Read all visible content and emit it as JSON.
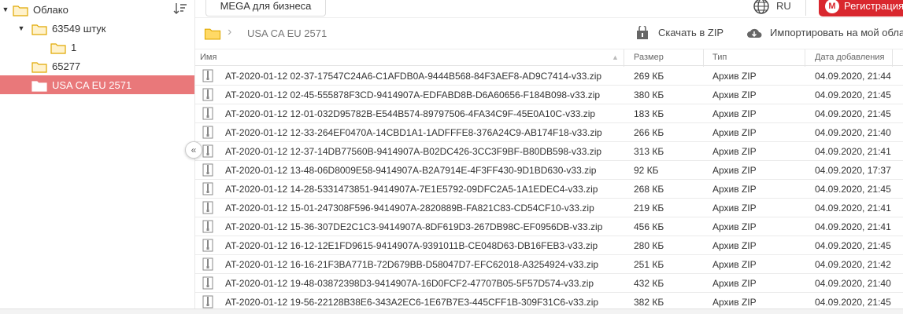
{
  "sidebar": {
    "items": [
      {
        "label": "Облако",
        "expanded": true,
        "selected": false
      },
      {
        "label": "63549 штук",
        "expanded": true,
        "selected": false
      },
      {
        "label": "1",
        "expanded": false,
        "selected": false
      },
      {
        "label": "65277",
        "expanded": false,
        "selected": false
      },
      {
        "label": "USA CA EU 2571",
        "expanded": false,
        "selected": true
      }
    ],
    "sort_icon": "sort-icon",
    "collapse_icon": "double-chevron-left-icon"
  },
  "topbar": {
    "business_label": "MEGA для бизнеса",
    "language": "RU",
    "register_label": "Регистрация",
    "register_logo": "M"
  },
  "breadcrumb": {
    "title": "USA CA EU 2571",
    "download_zip_label": "Скачать в ZIP",
    "import_label": "Импортировать на мой облако"
  },
  "table": {
    "columns": {
      "name": "Имя",
      "size": "Размер",
      "type": "Тип",
      "date": "Дата добавления"
    },
    "rows": [
      {
        "name": "AT-2020-01-12 02-37-17547C24A6-C1AFDB0A-9444B568-84F3AEF8-AD9C7414-v33.zip",
        "size": "269 КБ",
        "type": "Архив ZIP",
        "date": "04.09.2020, 21:44"
      },
      {
        "name": "AT-2020-01-12 02-45-555878F3CD-9414907A-EDFABD8B-D6A60656-F184B098-v33.zip",
        "size": "380 КБ",
        "type": "Архив ZIP",
        "date": "04.09.2020, 21:45"
      },
      {
        "name": "AT-2020-01-12 12-01-032D95782B-E544B574-89797506-4FA34C9F-45E0A10C-v33.zip",
        "size": "183 КБ",
        "type": "Архив ZIP",
        "date": "04.09.2020, 21:45"
      },
      {
        "name": "AT-2020-01-12 12-33-264EF0470A-14CBD1A1-1ADFFFE8-376A24C9-AB174F18-v33.zip",
        "size": "266 КБ",
        "type": "Архив ZIP",
        "date": "04.09.2020, 21:40"
      },
      {
        "name": "AT-2020-01-12 12-37-14DB77560B-9414907A-B02DC426-3CC3F9BF-B80DB598-v33.zip",
        "size": "313 КБ",
        "type": "Архив ZIP",
        "date": "04.09.2020, 21:41"
      },
      {
        "name": "AT-2020-01-12 13-48-06D8009E58-9414907A-B2A7914E-4F3FF430-9D1BD630-v33.zip",
        "size": "92 КБ",
        "type": "Архив ZIP",
        "date": "04.09.2020, 17:37"
      },
      {
        "name": "AT-2020-01-12 14-28-5331473851-9414907A-7E1E5792-09DFC2A5-1A1EDEC4-v33.zip",
        "size": "268 КБ",
        "type": "Архив ZIP",
        "date": "04.09.2020, 21:45"
      },
      {
        "name": "AT-2020-01-12 15-01-247308F596-9414907A-2820889B-FA821C83-CD54CF10-v33.zip",
        "size": "219 КБ",
        "type": "Архив ZIP",
        "date": "04.09.2020, 21:41"
      },
      {
        "name": "AT-2020-01-12 15-36-307DE2C1C3-9414907A-8DF619D3-267DB98C-EF0956DB-v33.zip",
        "size": "456 КБ",
        "type": "Архив ZIP",
        "date": "04.09.2020, 21:41"
      },
      {
        "name": "AT-2020-01-12 16-12-12E1FD9615-9414907A-9391011B-CE048D63-DB16FEB3-v33.zip",
        "size": "280 КБ",
        "type": "Архив ZIP",
        "date": "04.09.2020, 21:45"
      },
      {
        "name": "AT-2020-01-12 16-16-21F3BA771B-72D679BB-D58047D7-EFC62018-A3254924-v33.zip",
        "size": "251 КБ",
        "type": "Архив ZIP",
        "date": "04.09.2020, 21:42"
      },
      {
        "name": "AT-2020-01-12 19-48-03872398D3-9414907A-16D0FCF2-47707B05-5F57D574-v33.zip",
        "size": "432 КБ",
        "type": "Архив ZIP",
        "date": "04.09.2020, 21:40"
      },
      {
        "name": "AT-2020-01-12 19-56-22128B38E6-343A2EC6-1E67B7E3-445CFF1B-309F31C6-v33.zip",
        "size": "382 КБ",
        "type": "Архив ZIP",
        "date": "04.09.2020, 21:45"
      }
    ]
  },
  "colors": {
    "accent": "#d9272e",
    "selected_bg": "#e9787a",
    "folder": "#f9c74f"
  }
}
